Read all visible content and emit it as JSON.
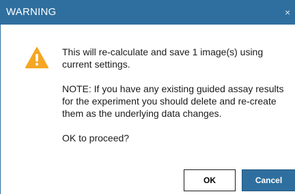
{
  "window": {
    "title": "WARNING",
    "close_label": "×"
  },
  "icon": "warning-icon",
  "message": {
    "line1": "This will re-calculate and save 1 image(s) using current settings.",
    "line2": "NOTE: If you have any existing guided assay results for the experiment you should delete and re-create them as the underlying data changes.",
    "line3": "OK to proceed?"
  },
  "buttons": {
    "ok_label": "OK",
    "cancel_label": "Cancel"
  },
  "colors": {
    "titlebar": "#2f6f9f",
    "warning": "#f5a623",
    "primary_button": "#2f6f9f"
  }
}
